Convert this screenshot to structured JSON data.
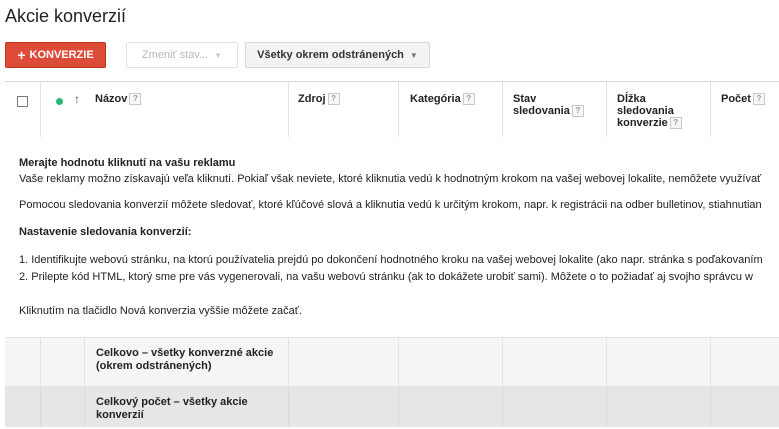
{
  "page": {
    "title": "Akcie konverzií"
  },
  "toolbar": {
    "new_conversion_label": "KONVERZIE",
    "change_status_label": "Zmeniť stav...",
    "filter_label": "Všetky okrem odstránených"
  },
  "table": {
    "columns": [
      {
        "label": "Názov"
      },
      {
        "label": "Zdroj"
      },
      {
        "label": "Kategória"
      },
      {
        "label": "Stav sledovania"
      },
      {
        "label": "Dĺžka sledovania konverzie"
      },
      {
        "label": "Počet"
      }
    ],
    "notice": {
      "heading": "Merajte hodnotu kliknutí na vašu reklamu",
      "line1": "Vaše reklamy možno získavajú veľa kliknutí. Pokiaľ však neviete, ktoré kliknutia vedú k hodnotným krokom na vašej webovej lokalite, nemôžete využívať",
      "line2": "Pomocou sledovania konverzií môžete sledovať, ktoré kľúčové slová a kliknutia vedú k určitým krokom, napr. k registrácii na odber bulletinov, stiahnutian",
      "setup_heading": "Nastavenie sledovania konverzií:",
      "step1": "1. Identifikujte webovú stránku, na ktorú používatelia prejdú po dokončení hodnotného kroku na vašej webovej lokalite (ako napr. stránka s poďakovaním",
      "step2": "2. Prilepte kód HTML, ktorý sme pre vás vygenerovali, na vašu webovú stránku (ak to dokážete urobiť sami). Môžete o to požiadať aj svojho správcu w",
      "footer": "Kliknutím na tlačidlo Nová konverzia vyššie môžete začať."
    },
    "summary_rows": [
      {
        "label": "Celkovo – všetky konverzné akcie (okrem odstránených)"
      },
      {
        "label": "Celkový počet – všetky akcie konverzií"
      }
    ]
  }
}
